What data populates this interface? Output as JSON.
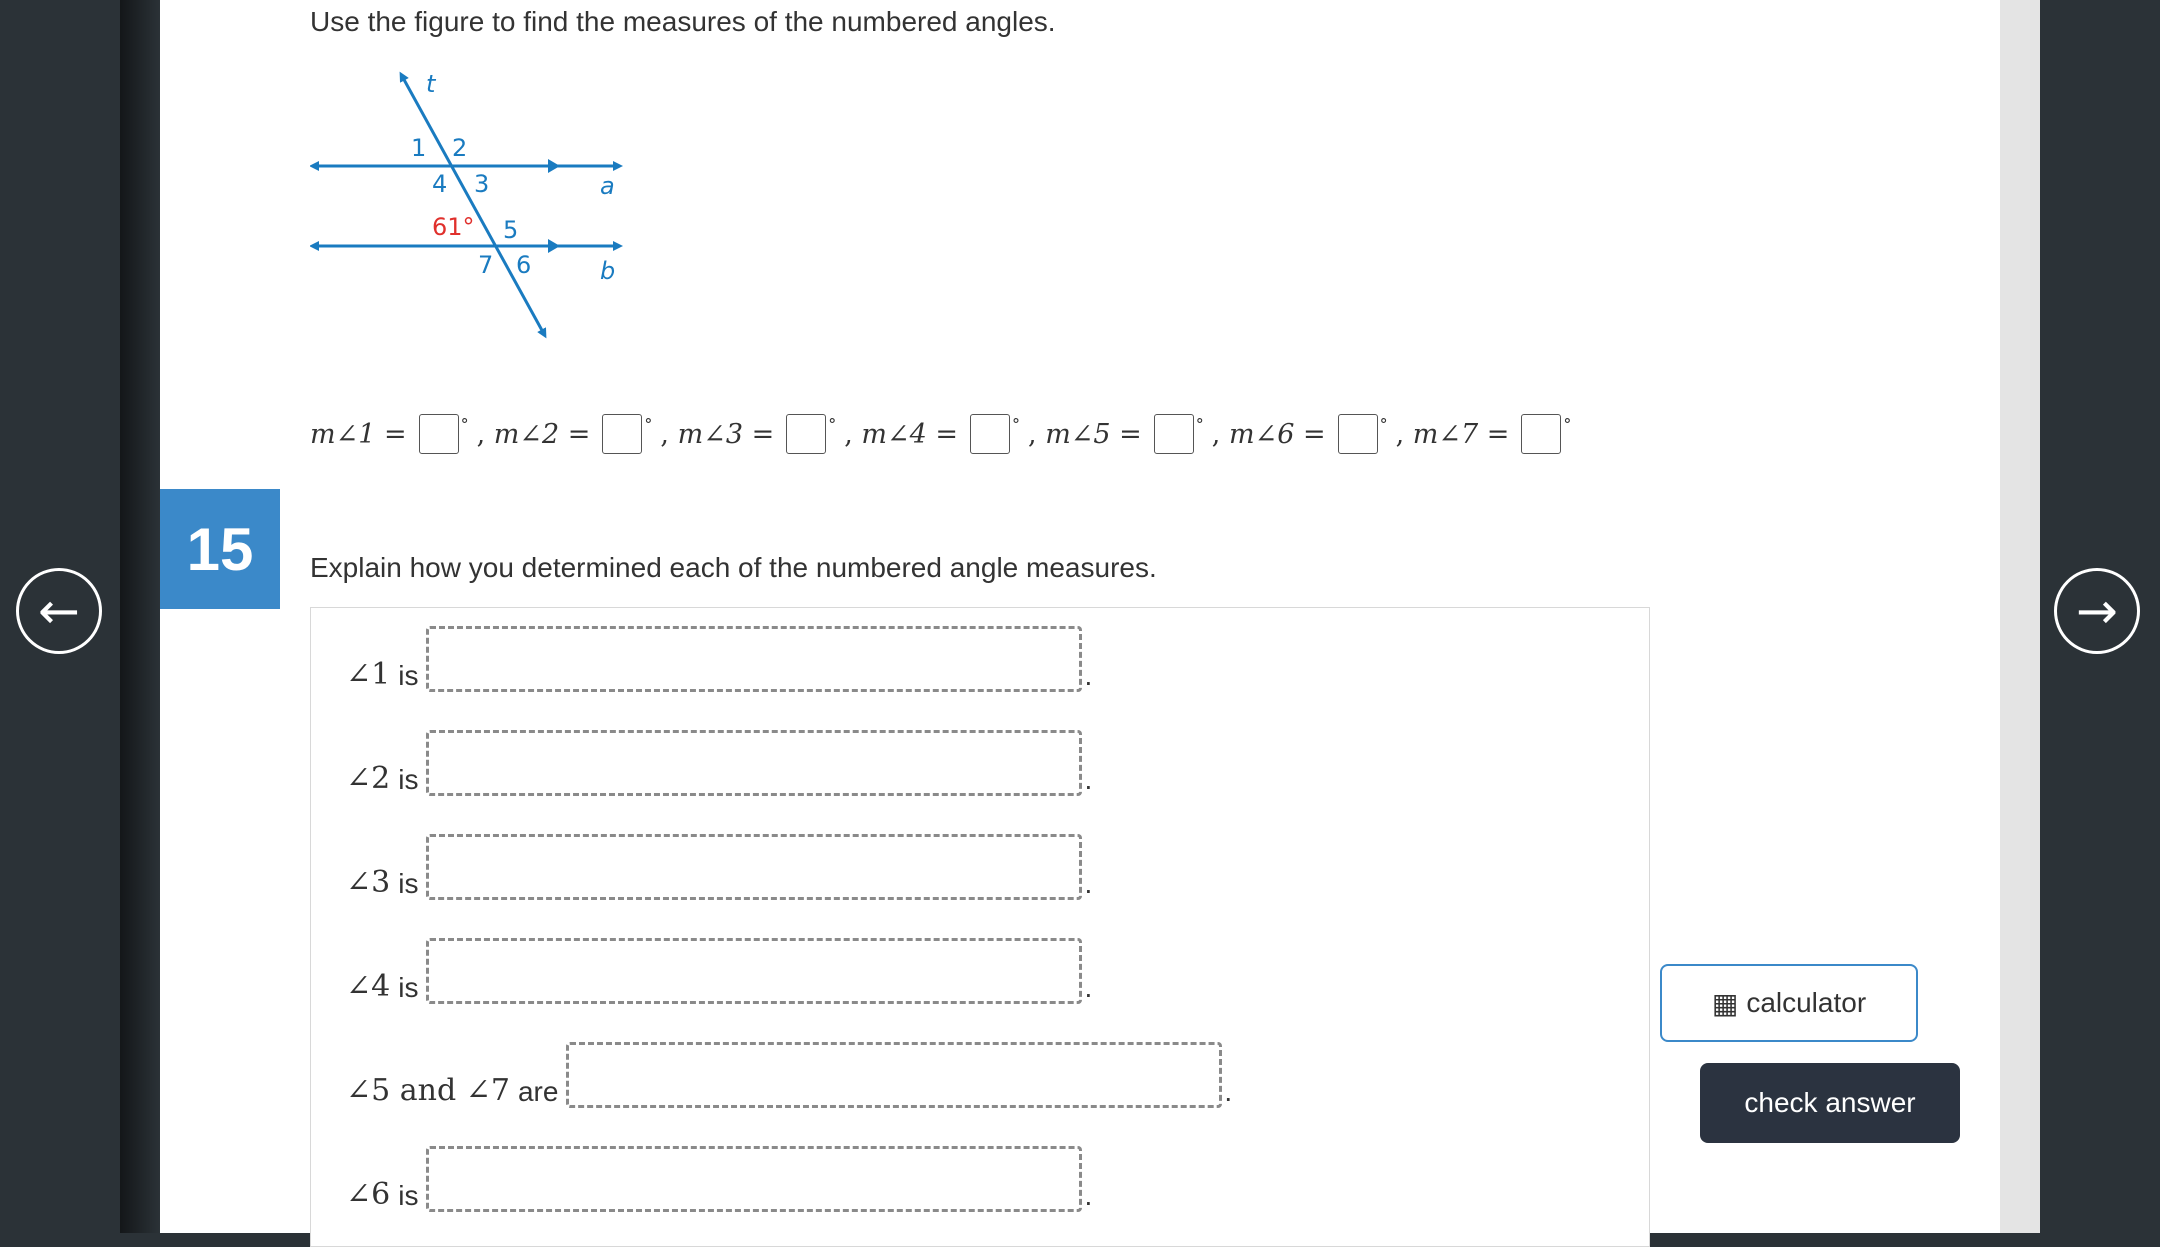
{
  "prompt": "Use the figure to find the measures of the numbered angles.",
  "figure": {
    "line_labels": {
      "t": "t",
      "a": "a",
      "b": "b"
    },
    "angle_labels": [
      "1",
      "2",
      "3",
      "4",
      "5",
      "6",
      "7"
    ],
    "given_angle": "61°",
    "colors": {
      "lines": "#1a7bc0",
      "given": "#e0302c",
      "text": "#1a7bc0"
    }
  },
  "math_answers": [
    {
      "label": "m∠1 ="
    },
    {
      "label": "m∠2 ="
    },
    {
      "label": "m∠3 ="
    },
    {
      "label": "m∠4 ="
    },
    {
      "label": "m∠5 ="
    },
    {
      "label": "m∠6 ="
    },
    {
      "label": "m∠7 ="
    }
  ],
  "degree_symbol": "°",
  "separator": ",",
  "question_number": "15",
  "explain_prompt": "Explain how you determined each of the numbered angle measures.",
  "explain_rows": [
    {
      "label": "∠1",
      "word": "is"
    },
    {
      "label": "∠2",
      "word": "is"
    },
    {
      "label": "∠3",
      "word": "is"
    },
    {
      "label": "∠4",
      "word": "is"
    },
    {
      "label": "∠5 and ∠7",
      "word": "are"
    },
    {
      "label": "∠6",
      "word": "is"
    }
  ],
  "period": ".",
  "nav": {
    "prev": "←",
    "next": "→"
  },
  "calculator_label": "calculator",
  "calculator_icon": "calculator-icon",
  "check_answer_label": "check answer",
  "accent_color": "#3b89c9"
}
